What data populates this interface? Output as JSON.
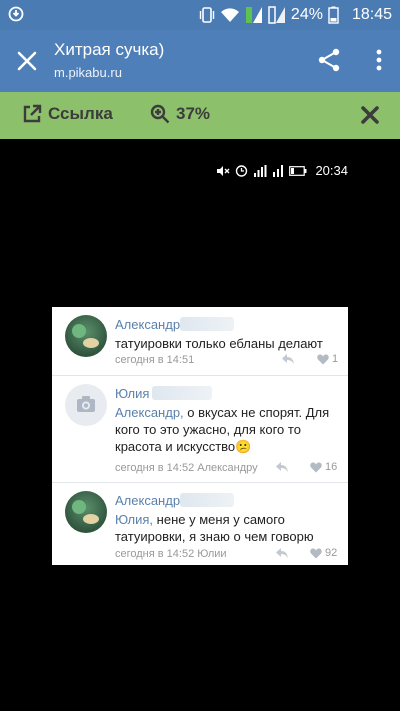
{
  "status_bar": {
    "battery": "24%",
    "time": "18:45"
  },
  "app_bar": {
    "title": "Хитрая сучка)",
    "url": "m.pikabu.ru"
  },
  "toolbar": {
    "link_label": "Ссылка",
    "zoom_label": "37%"
  },
  "phone_status": {
    "time": "20:34"
  },
  "comments": [
    {
      "author": "Александр",
      "text": "татуировки только ебланы делают",
      "meta": "сегодня в 14:51",
      "likes": "1"
    },
    {
      "author": "Юлия",
      "mention": "Александр,",
      "text": " о вкусах не спорят. Для кого то это ужасно,  для кого то красота и искусство",
      "emoji": "😕",
      "meta": "сегодня в 14:52 Александру",
      "likes": "16"
    },
    {
      "author": "Александр",
      "mention": "Юлия,",
      "text": " нене у меня у самого татуировки, я знаю о чем говорю",
      "meta": "сегодня в 14:52 Юлии",
      "likes": "92"
    }
  ],
  "colors": {
    "app_bar": "#4f7fb8",
    "green_bar": "#8dc06a",
    "link": "#5a81ad"
  }
}
